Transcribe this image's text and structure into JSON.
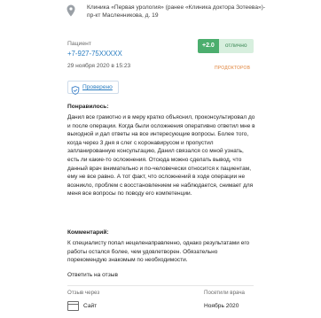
{
  "clinic": {
    "address": "Клиника «Первая урология» (ранее «Клиника доктора Зотеева»)-пр-кт Масленникова, д. 19"
  },
  "patient": {
    "label": "Пациент",
    "phone": "+7-927-75XXXXX",
    "date": "29 ноября 2020 в 15:23"
  },
  "rating": {
    "value": "+2.0",
    "label": "отлично",
    "accent": "#4cae6e"
  },
  "source_brand": "ПРОДОКТОРОВ",
  "verified": {
    "label": "Проверено",
    "icon": "shield-check-icon"
  },
  "review": {
    "liked_heading": "Понравилось:",
    "liked_text": "Данил все грамотно и в меру кратко объяснил, проконсультировал до и после операции. Когда были осложнения оперативно ответил мне в выходной и дал ответы на все интересующие вопросы. Более того, когда через 3 дня я слег с коронавирусом и пропустил запланированную консультацию, Данил связался со мной узнать, есть ли какие-то осложнения. Отсюда можно сделать вывод, что данный врач внимательно и по-человечески относится к пациентам, ему не все равно. А тот факт, что осложнений в ходе операции не возникло, проблем с восстановлением не наблюдается, снимает для меня все вопросы по поводу его компетенции.",
    "comment_heading": "Комментарий:",
    "comment_text": "К специалисту попал нецеленаправленно, однако результатами его работы остался более, чем удовлетворен. Обязательно порекомендую знакомым по необходимости."
  },
  "actions": {
    "reply": "Ответить на отзыв"
  },
  "meta": {
    "via_label": "Отзыв через",
    "via_value": "Сайт",
    "visits_label": "Посетили врача",
    "visits_value": "Ноябрь 2020"
  }
}
